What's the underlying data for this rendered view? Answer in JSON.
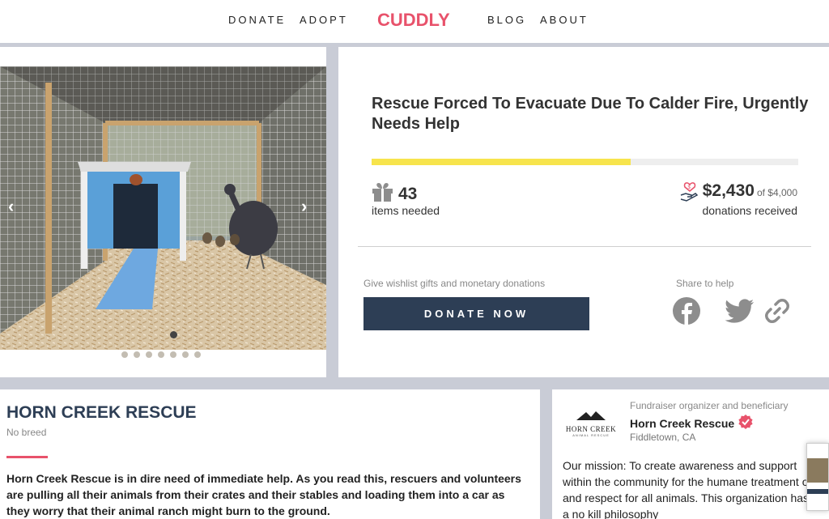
{
  "nav": {
    "donate": "DONATE",
    "adopt": "ADOPT",
    "logo": "CUDDLY",
    "blog": "BLOG",
    "about": "ABOUT"
  },
  "campaign": {
    "title": "Rescue Forced To Evacuate Due To Calder Fire, Urgently Needs Help",
    "progress_fraction": 0.608,
    "items_count": "43",
    "items_label": "items needed",
    "donations_amount": "$2,430",
    "donations_goal": "of $4,000",
    "donations_label": "donations received",
    "give_text": "Give wishlist gifts and monetary donations",
    "donate_button": "DONATE NOW",
    "share_label": "Share to help"
  },
  "carousel": {
    "prev_icon": "chevron-left-icon",
    "next_icon": "chevron-right-icon",
    "dot_count": 7
  },
  "about": {
    "name": "HORN CREEK RESCUE",
    "breed": "No breed",
    "text": "Horn Creek Rescue is in dire need of immediate help. As you read this, rescuers and volunteers are pulling all their animals from their crates and their stables and loading them into a car as they worry that their animal ranch might burn to the ground."
  },
  "organizer": {
    "role": "Fundraiser organizer and beneficiary",
    "name": "Horn Creek Rescue",
    "location": "Fiddletown,  CA",
    "logo_text": "HORN CREEK",
    "logo_sub": "ANIMAL RESCUE",
    "mission": "Our mission: To create awareness and support within the community for the humane treatment of and respect for all animals. This organization has a no kill philosophy"
  },
  "colors": {
    "brand": "#e8526b",
    "navy": "#2d3e55",
    "progress": "#f7e44c"
  }
}
